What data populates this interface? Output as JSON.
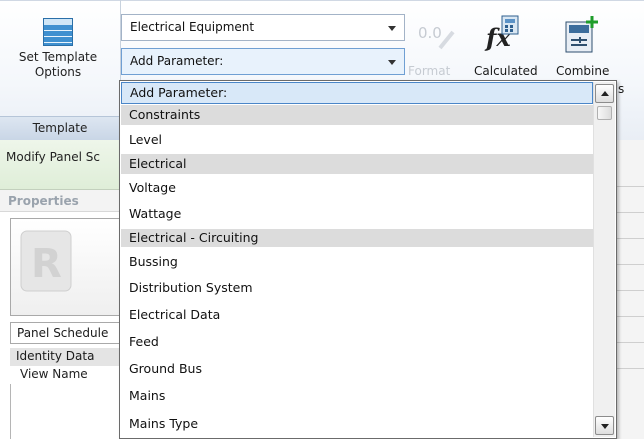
{
  "ribbon": {
    "template_button_label": "Set Template Options",
    "template_group_label": "Template",
    "category_combo_value": "Electrical Equipment",
    "parameter_combo_value": "Add Parameter:",
    "format_value": "0.0",
    "format_label": "Format",
    "calculated_label": "Calculated",
    "combine_label": "Combine",
    "combine_suffix": "s"
  },
  "left_panel": {
    "modify_label": "Modify Panel Sc",
    "properties_title": "Properties",
    "type_selector": "Panel Schedule",
    "identity_group": "Identity Data",
    "view_name_label": "View Name"
  },
  "dropdown": {
    "items": [
      {
        "label": "Add Parameter:",
        "kind": "selected"
      },
      {
        "label": "Constraints",
        "kind": "header"
      },
      {
        "label": "Level",
        "kind": "item"
      },
      {
        "label": "Electrical",
        "kind": "header"
      },
      {
        "label": "Voltage",
        "kind": "item"
      },
      {
        "label": "Wattage",
        "kind": "item"
      },
      {
        "label": "Electrical - Circuiting",
        "kind": "header"
      },
      {
        "label": "Bussing",
        "kind": "item"
      },
      {
        "label": "Distribution System",
        "kind": "item"
      },
      {
        "label": "Electrical Data",
        "kind": "item"
      },
      {
        "label": "Feed",
        "kind": "item"
      },
      {
        "label": "Ground Bus",
        "kind": "item"
      },
      {
        "label": "Mains",
        "kind": "item"
      },
      {
        "label": "Mains Type",
        "kind": "item"
      }
    ]
  },
  "icons": {
    "template": "table-grid-icon",
    "format": "format-pencil-icon",
    "calculated": "function-fx-icon",
    "combine": "combine-parameters-icon"
  }
}
